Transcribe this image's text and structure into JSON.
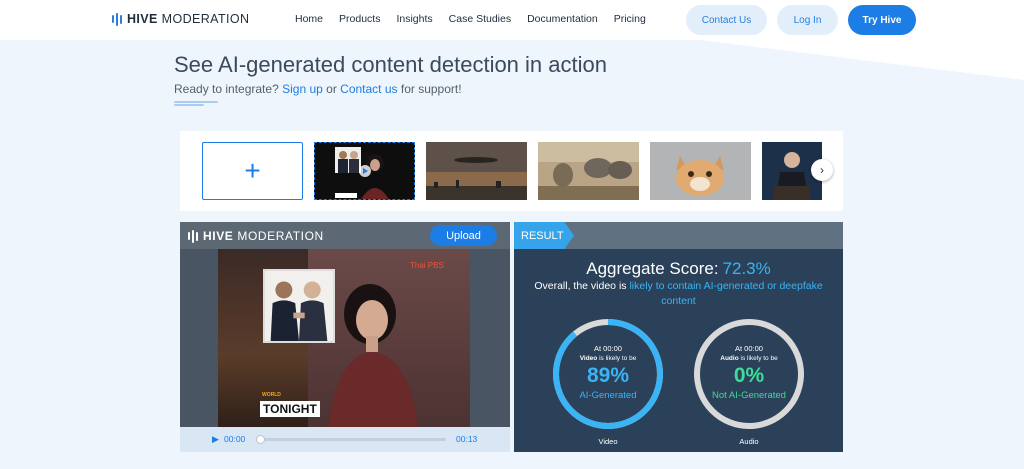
{
  "nav": {
    "brand_bold": "HIVE",
    "brand_rest": "MODERATION",
    "links": [
      "Home",
      "Products",
      "Insights",
      "Case Studies",
      "Documentation",
      "Pricing"
    ],
    "contact_label": "Contact Us",
    "login_label": "Log In",
    "try_label": "Try Hive",
    "accent_color": "#1c7de6"
  },
  "hero": {
    "title": "See AI-generated content detection in action",
    "sub_prefix": "Ready to integrate?",
    "signup_label": "Sign up",
    "sub_or": "or",
    "contact_label": "Contact us",
    "sub_suffix": "for support!"
  },
  "carousel": {
    "add_icon": "+",
    "next_icon": "›",
    "thumbnails": [
      "video-news-anchor",
      "sunset-city",
      "elephants-painting",
      "cat-photo",
      "president-podium"
    ]
  },
  "video_panel": {
    "brand_bold": "HIVE",
    "brand_rest": "MODERATION",
    "upload_label": "Upload",
    "overlay_title": "TONIGHT",
    "overlay_tag": "WORLD",
    "channel_logo": "Thai PBS",
    "time_current": "00:00",
    "time_total": "00:13",
    "progress": 0
  },
  "result": {
    "tag": "RESULT",
    "agg_label": "Aggregate Score:",
    "agg_value": "72.3%",
    "overall_prefix": "Overall, the video is",
    "overall_highlight": "likely to contain AI-generated or deepfake content",
    "video": {
      "at": "At 00:00",
      "likely_bold": "Video",
      "likely_rest": "is likely to be",
      "percent": "89%",
      "verdict": "AI-Generated",
      "label": "Video",
      "fraction": 0.89,
      "color": "#3ab4f5"
    },
    "audio": {
      "at": "At 00:00",
      "likely_bold": "Audio",
      "likely_rest": "is likely to be",
      "percent": "0%",
      "verdict": "Not AI-Generated",
      "label": "Audio",
      "fraction": 0,
      "color": "#3ddc97"
    }
  }
}
